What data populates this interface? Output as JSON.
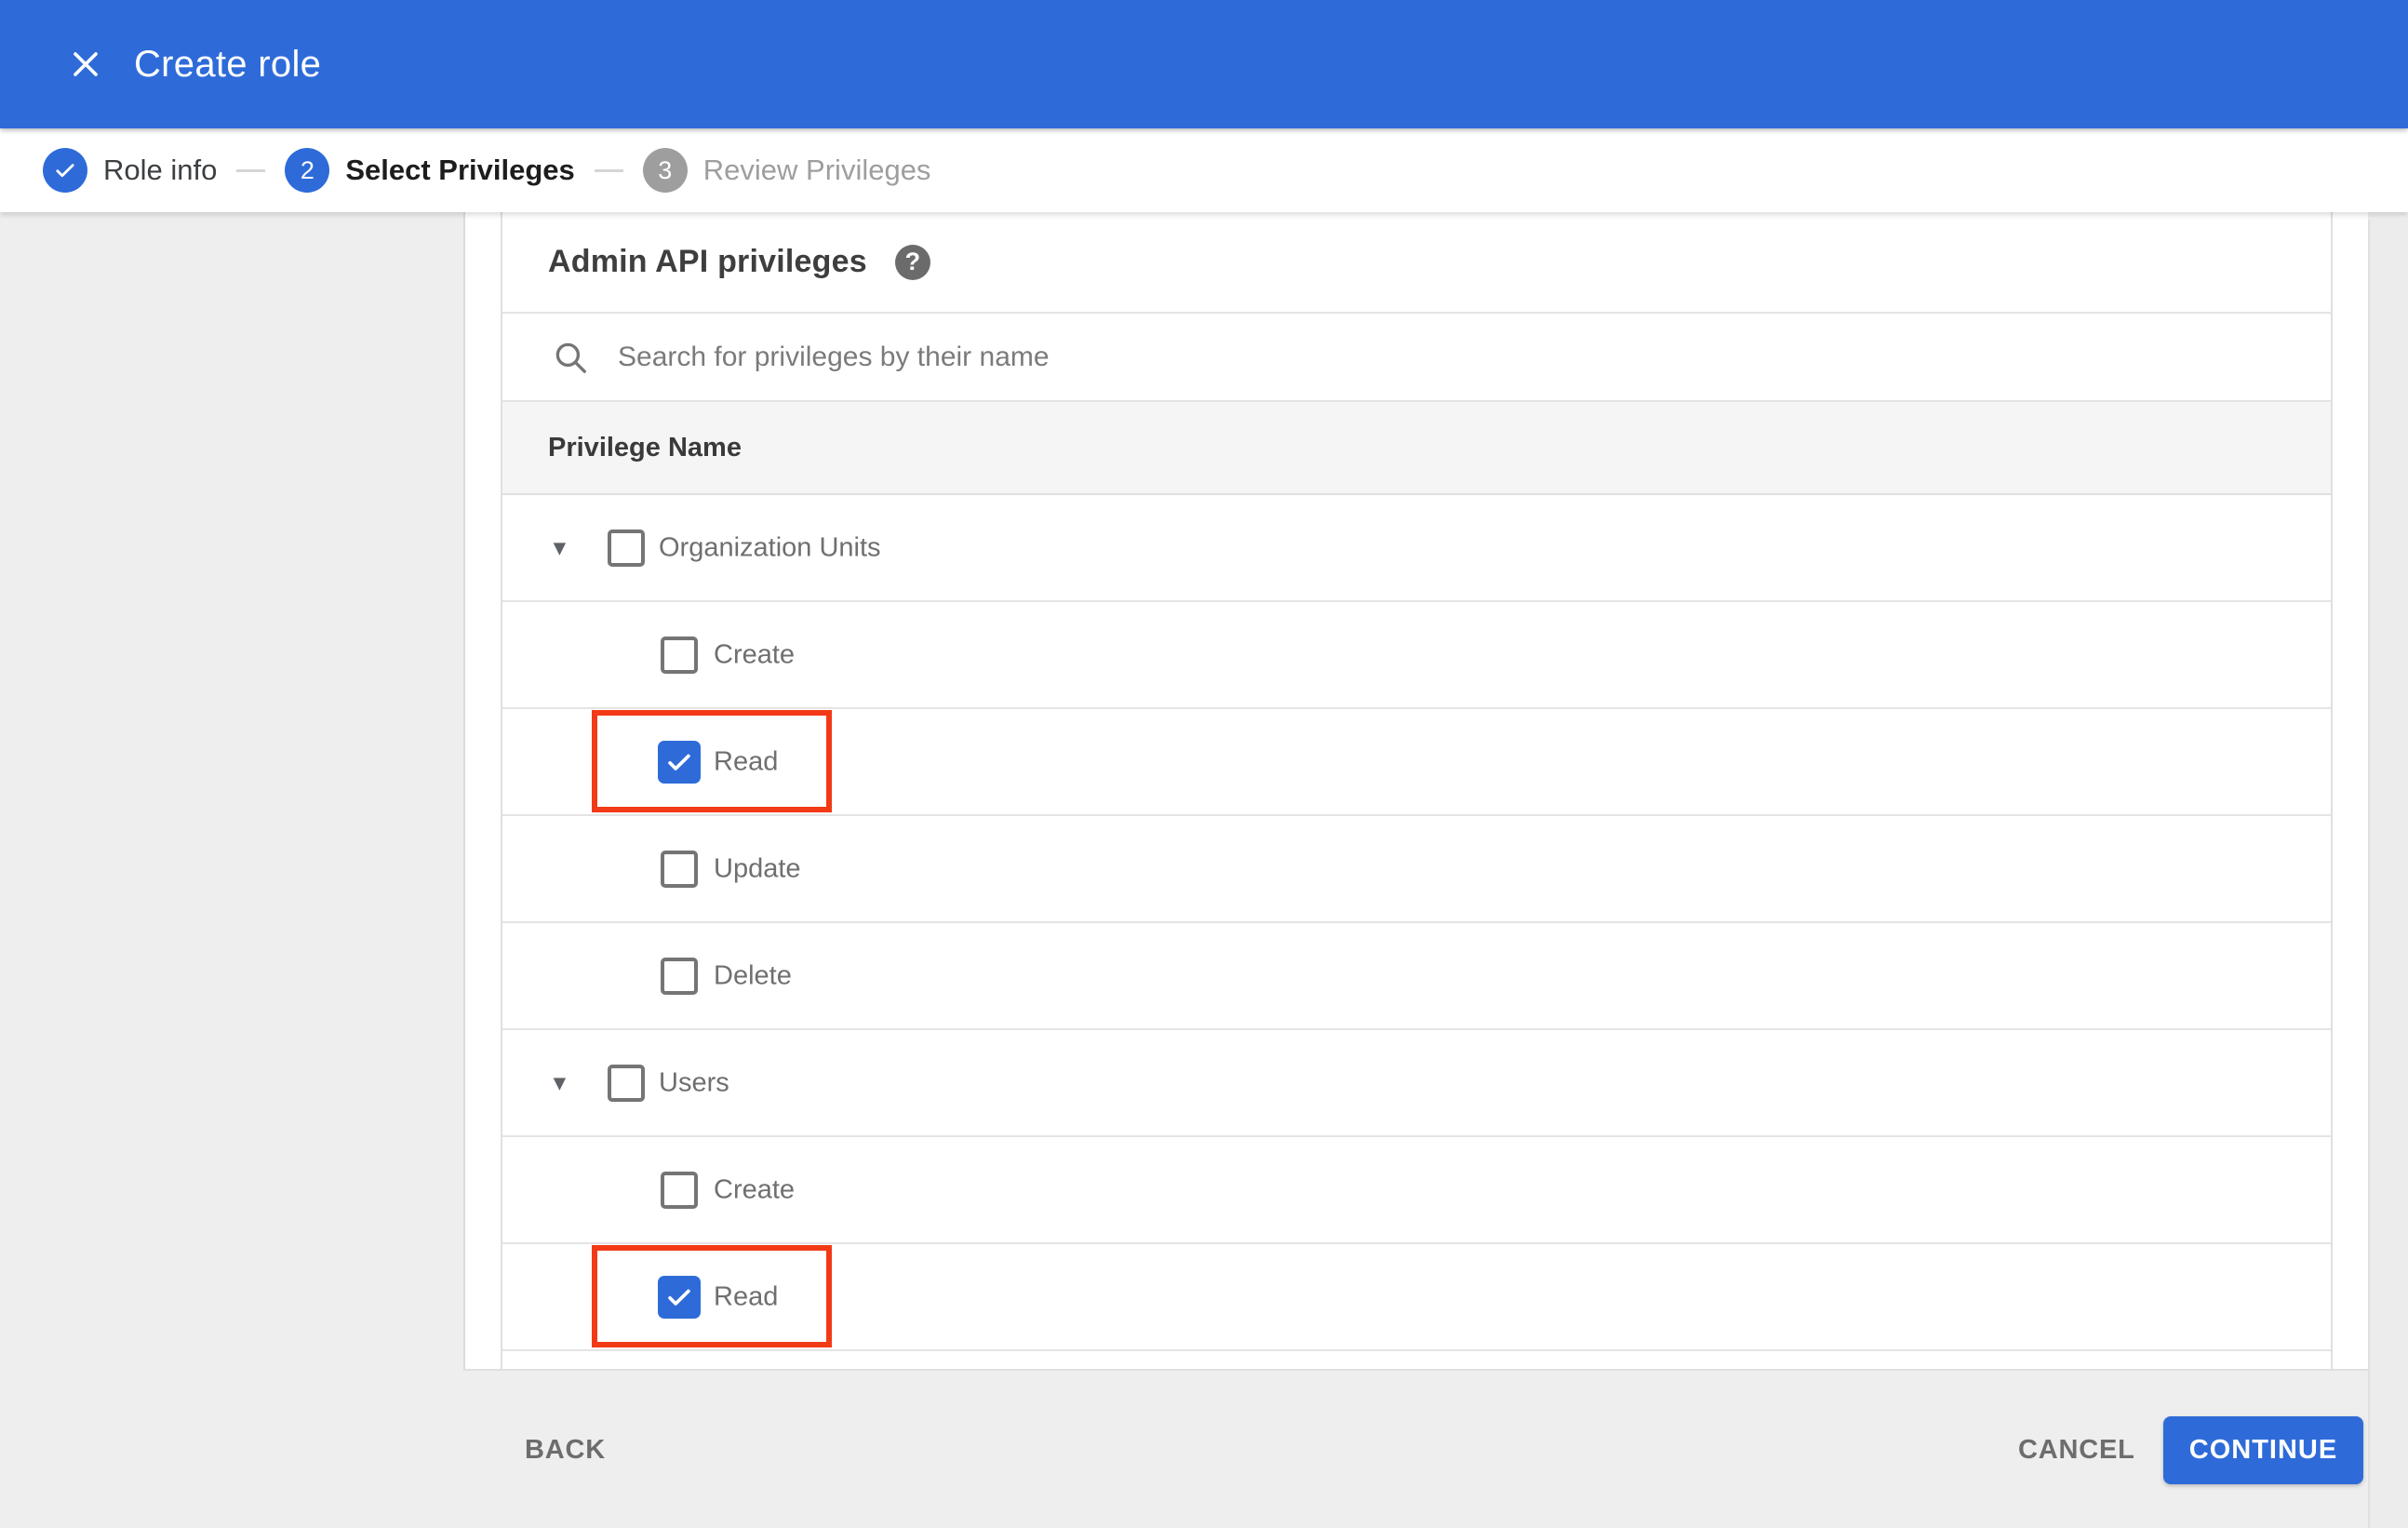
{
  "header": {
    "title": "Create role"
  },
  "icons": {
    "close": "close-x",
    "help": "?",
    "step_check": "checkmark",
    "expand_arrow": "▼",
    "search": "magnifier",
    "checkbox_check": "checkmark"
  },
  "stepper": {
    "steps": [
      {
        "number": "1",
        "label": "Role info",
        "state": "completed"
      },
      {
        "number": "2",
        "label": "Select Privileges",
        "state": "active"
      },
      {
        "number": "3",
        "label": "Review Privileges",
        "state": "upcoming"
      }
    ]
  },
  "content": {
    "heading": "Admin API privileges",
    "search_placeholder": "Search for privileges by their name",
    "table": {
      "header": "Privilege Name",
      "rows": [
        {
          "label": "Organization Units",
          "indent": "parent",
          "expanded": true,
          "checked": false,
          "highlighted": false
        },
        {
          "label": "Create",
          "indent": "child",
          "expanded": false,
          "checked": false,
          "highlighted": false
        },
        {
          "label": "Read",
          "indent": "child",
          "expanded": false,
          "checked": true,
          "highlighted": true
        },
        {
          "label": "Update",
          "indent": "child",
          "expanded": false,
          "checked": false,
          "highlighted": false
        },
        {
          "label": "Delete",
          "indent": "child",
          "expanded": false,
          "checked": false,
          "highlighted": false
        },
        {
          "label": "Users",
          "indent": "parent",
          "expanded": true,
          "checked": false,
          "highlighted": false
        },
        {
          "label": "Create",
          "indent": "child",
          "expanded": false,
          "checked": false,
          "highlighted": false
        },
        {
          "label": "Read",
          "indent": "child",
          "expanded": false,
          "checked": true,
          "highlighted": true
        }
      ]
    }
  },
  "footer": {
    "back": "BACK",
    "cancel": "CANCEL",
    "continue": "CONTINUE"
  },
  "colors": {
    "primary_blue": "#2e6bd9",
    "annotation_red": "#f23a17",
    "page_background": "#eeeeee",
    "panel_background": "#ffffff",
    "table_header_background": "#f5f5f5",
    "divider": "#e4e4e4",
    "inactive_step_gray": "#9e9e9e",
    "row_label_gray": "#6f6f6f"
  }
}
